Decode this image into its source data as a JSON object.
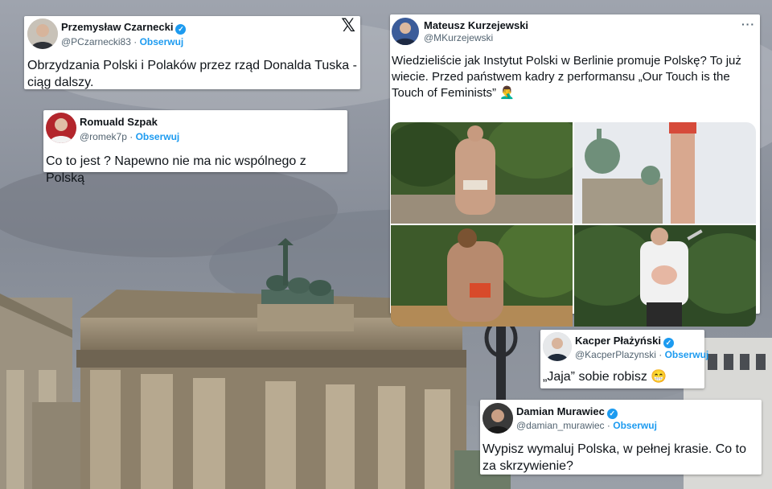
{
  "tweets": [
    {
      "name": "Przemysław Czarnecki",
      "verified": true,
      "handle": "@PCzarnecki83",
      "follow": "Obserwuj",
      "separator": "·",
      "text": "Obrzydzania Polski i Polaków przez rząd Donalda Tuska - ciąg dalszy.",
      "icon": "x-logo-icon"
    },
    {
      "name": "Romuald Szpak",
      "verified": false,
      "handle": "@romek7p",
      "follow": "Obserwuj",
      "separator": "·",
      "text": "Co to jest ? Napewno nie ma nic wspólnego z Polską"
    },
    {
      "name": "Mateusz Kurzejewski",
      "verified": false,
      "handle": "@MKurzejewski",
      "text": "Wiedzieliście jak Instytut Polski w Berlinie promuje Polskę? To już wiecie. Przed państwem kadry z performansu „Our Touch is the Touch of Feminists” 🤦‍♂️",
      "menu": "···"
    },
    {
      "name": "Kacper Płażyński",
      "verified": true,
      "handle": "@KacperPlazynski",
      "follow": "Obserwuj",
      "separator": "·",
      "text": "„Jaja” sobie robisz 😁"
    },
    {
      "name": "Damian Murawiec",
      "verified": true,
      "handle": "@damian_murawiec",
      "follow": "Obserwuj",
      "separator": "·",
      "text": "Wypisz wymaluj Polska, w pełnej krasie. Co to za skrzywienie?"
    }
  ],
  "colors": {
    "verified": "#1d9bf0",
    "follow": "#1d9bf0",
    "handle": "#536471",
    "text": "#0f1419"
  }
}
